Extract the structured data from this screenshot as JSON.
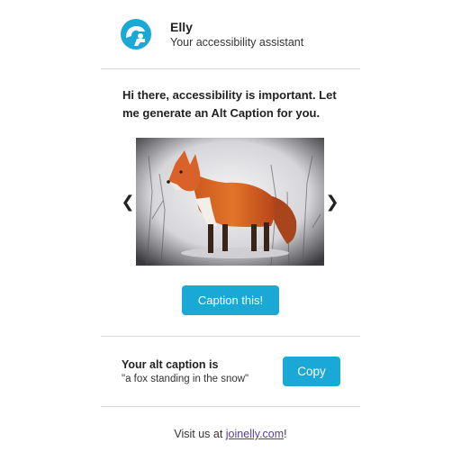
{
  "header": {
    "app_name": "Elly",
    "subtitle": "Your accessibility assistant",
    "logo_icon": "elly-logo-icon",
    "brand_color": "#1aa8d6"
  },
  "intro": {
    "message": "Hi there, accessibility is important. Let me generate an Alt Caption for you."
  },
  "carousel": {
    "prev_icon": "chevron-left-icon",
    "next_icon": "chevron-right-icon",
    "prev_glyph": "❮",
    "next_glyph": "❯",
    "image_subject": "fox-photo"
  },
  "caption_button": {
    "label": "Caption this!"
  },
  "result": {
    "title": "Your alt caption is",
    "caption": "\"a fox standing in the snow\"",
    "copy_label": "Copy"
  },
  "footer": {
    "prefix": "Visit us at ",
    "link_text": "joinelly.com",
    "suffix": "!",
    "link_color": "#5a3d8c"
  }
}
